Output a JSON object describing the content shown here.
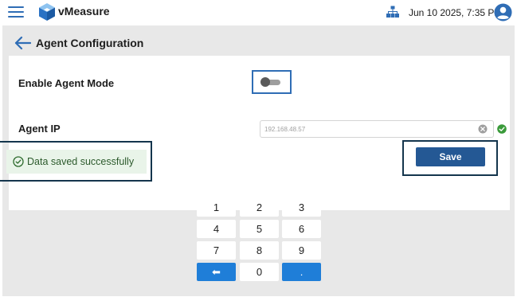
{
  "app": {
    "name": "vMeasure",
    "datetime": "Jun 10 2025, 7:35 PM"
  },
  "page": {
    "title": "Agent Configuration"
  },
  "form": {
    "enable_agent_label": "Enable Agent Mode",
    "enable_agent_on": false,
    "agent_ip_label": "Agent IP",
    "agent_ip_value": "192.168.48.57",
    "agent_ip_valid": true,
    "save_label": "Save"
  },
  "toast": {
    "message": "Data saved successfully"
  },
  "keypad": {
    "keys": [
      "1",
      "2",
      "3",
      "4",
      "5",
      "6",
      "7",
      "8",
      "9",
      "⬅",
      "0",
      "."
    ]
  },
  "colors": {
    "accent": "#2f6db5",
    "save_button": "#245894",
    "keypad_action": "#1f7ed8",
    "success": "#3a9a3a",
    "toast_bg": "#e9f4e9"
  },
  "icons": {
    "menu": "hamburger-menu-icon",
    "logo": "vmeasure-cube-logo-icon",
    "network": "network-tree-icon",
    "account": "account-circle-icon",
    "back": "arrow-left-icon",
    "clear": "clear-circle-icon",
    "valid": "check-circle-icon",
    "toast": "check-circle-outline-icon"
  }
}
